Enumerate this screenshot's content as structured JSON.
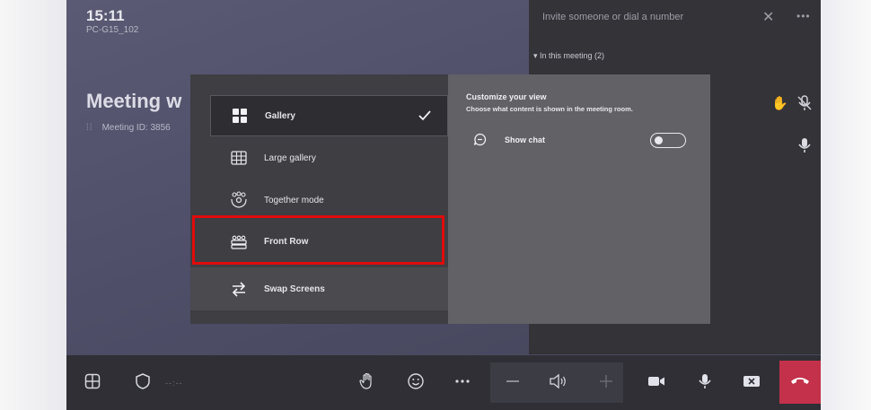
{
  "header": {
    "time": "15:11",
    "device_name": "PC-G15_102",
    "meeting_title": "Meeting w",
    "meeting_id_label": "Meeting ID: 3856"
  },
  "participants_panel": {
    "invite_placeholder": "Invite someone or dial a number",
    "in_this_meeting": "▾ In this meeting (2)"
  },
  "view_menu": {
    "options": [
      {
        "label": "Gallery",
        "icon": "gallery-icon",
        "selected": true
      },
      {
        "label": "Large gallery",
        "icon": "large-gallery-icon",
        "selected": false
      },
      {
        "label": "Together mode",
        "icon": "together-mode-icon",
        "selected": false
      },
      {
        "label": "Front Row",
        "icon": "front-row-icon",
        "selected": false,
        "highlighted": true
      },
      {
        "label": "Swap Screens",
        "icon": "swap-screens-icon",
        "selected": false
      }
    ]
  },
  "customize": {
    "title": "Customize your view",
    "description": "Choose what content is shown in the meeting room.",
    "show_chat_label": "Show chat",
    "show_chat_enabled": false
  },
  "toolbar": {
    "status_text": "--:--",
    "buttons": [
      "layout-icon",
      "shield-icon",
      "raise-hand-icon",
      "reactions-icon",
      "more-options-icon",
      "volume-down-icon",
      "speaker-icon",
      "volume-up-icon",
      "camera-icon",
      "microphone-icon",
      "share-screen-icon",
      "hang-up-icon"
    ]
  },
  "colors": {
    "highlight_border": "#e00b0b",
    "end_call": "#c4314b",
    "hand_raised": "#d9a441"
  }
}
